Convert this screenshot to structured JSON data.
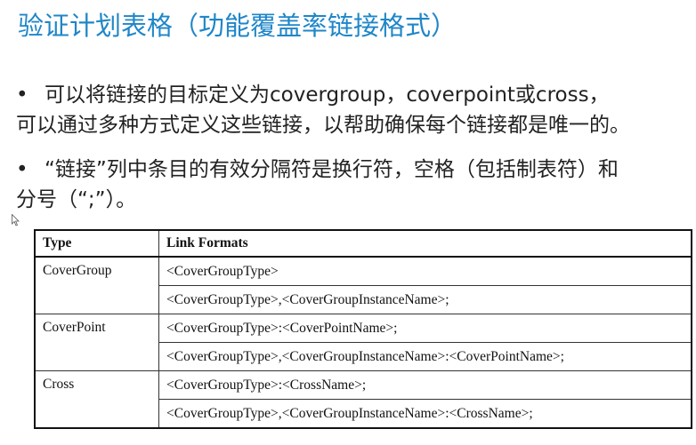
{
  "title": "验证计划表格（功能覆盖率链接格式）",
  "bullets": [
    {
      "marker": "•",
      "line1": "可以将链接的目标定义为covergroup，coverpoint或cross，",
      "line2": "可以通过多种方式定义这些链接，以帮助确保每个链接都是唯一的。"
    },
    {
      "marker": "•",
      "line1": "“链接”列中条目的有效分隔符是换行符，空格（包括制表符）和",
      "line2": "分号（“;”）。"
    }
  ],
  "table": {
    "headers": [
      "Type",
      "Link Formats"
    ],
    "groups": [
      {
        "type": "CoverGroup",
        "formats": [
          "<CoverGroupType>",
          "<CoverGroupType>,<CoverGroupInstanceName>;"
        ]
      },
      {
        "type": "CoverPoint",
        "formats": [
          "<CoverGroupType>:<CoverPointName>;",
          "<CoverGroupType>,<CoverGroupInstanceName>:<CoverPointName>;"
        ]
      },
      {
        "type": "Cross",
        "formats": [
          "<CoverGroupType>:<CrossName>;",
          "<CoverGroupType>,<CoverGroupInstanceName>:<CrossName>;"
        ]
      }
    ]
  },
  "colors": {
    "title": "#1f86c8",
    "text": "#222222",
    "border": "#111111"
  },
  "icons": {
    "cursor": "mouse-pointer-icon"
  }
}
